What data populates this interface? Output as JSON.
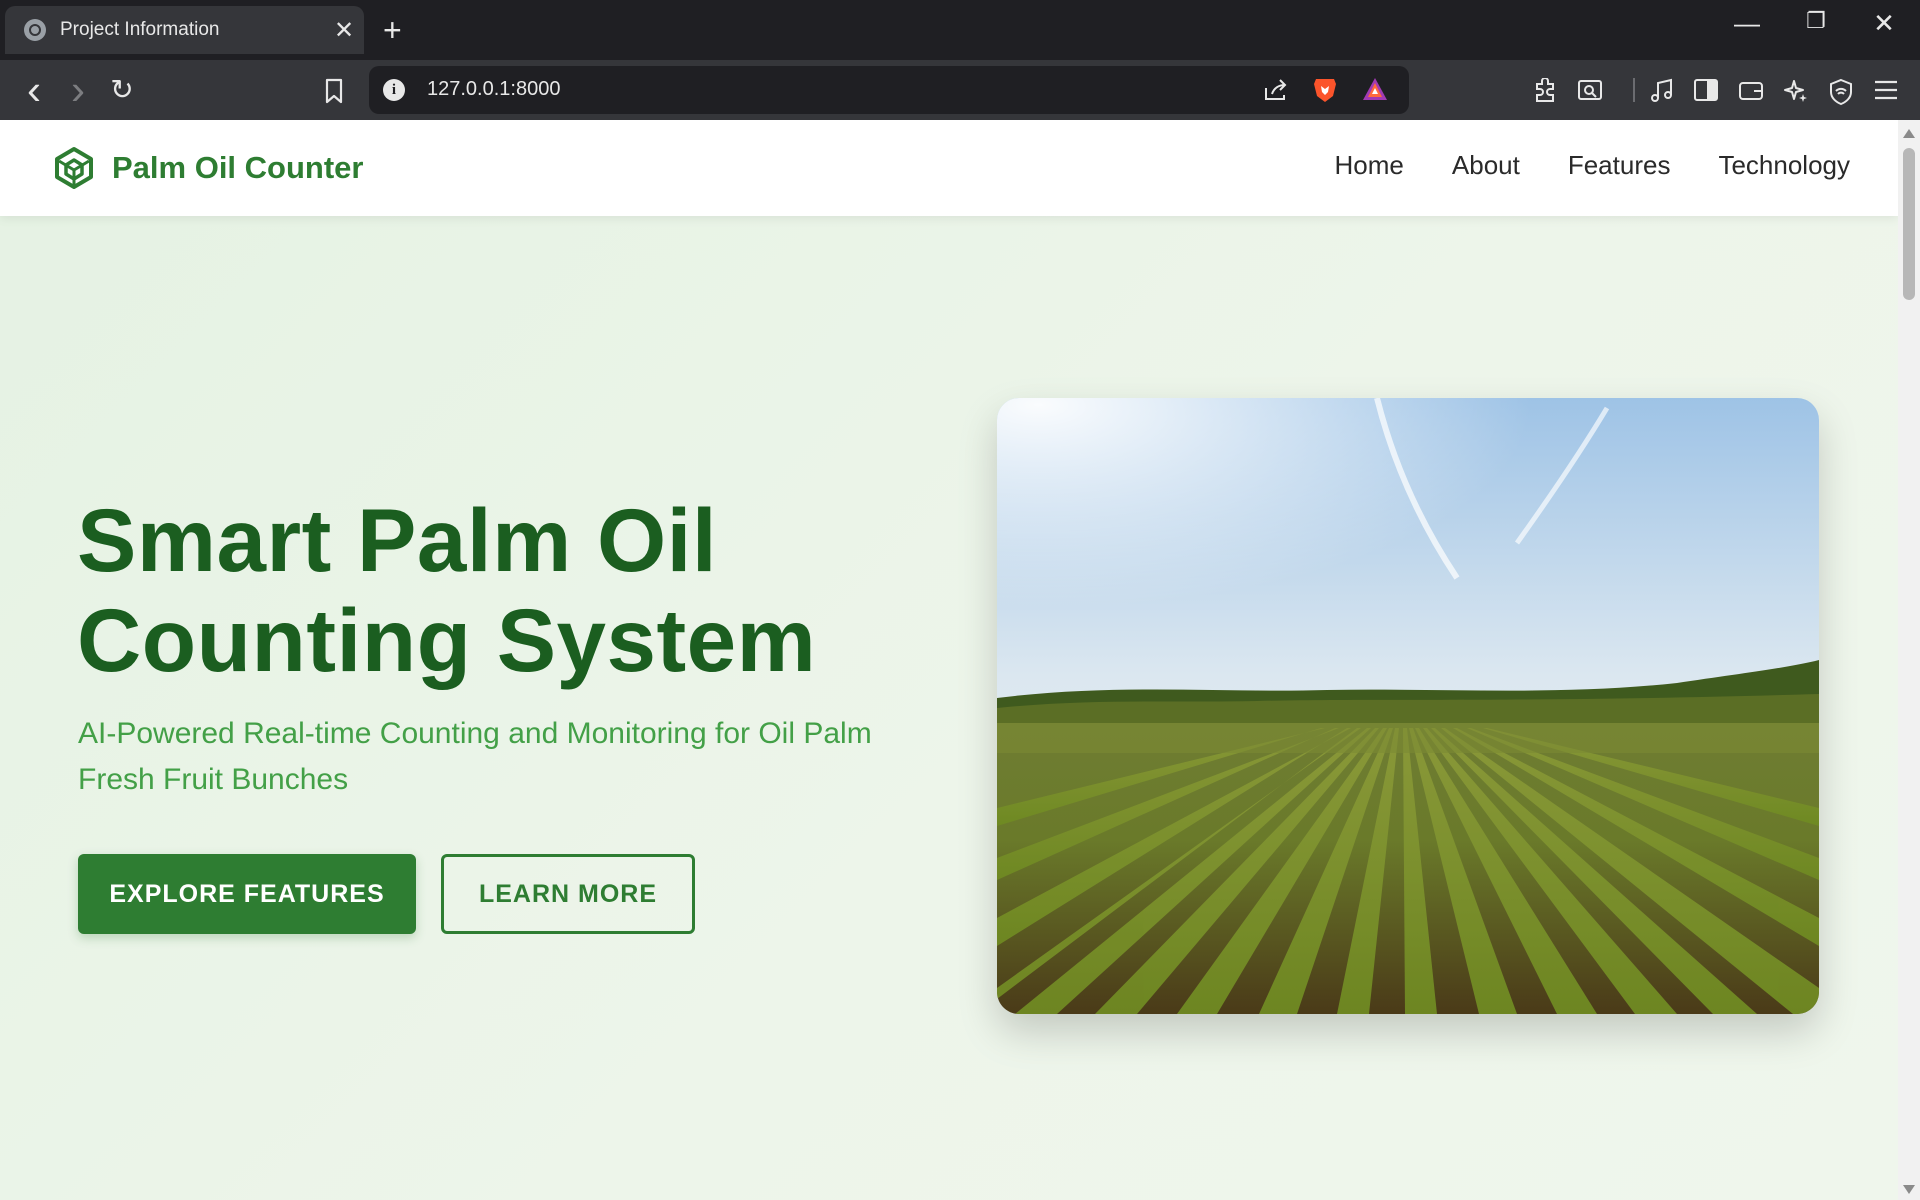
{
  "browser": {
    "tab_title": "Project Information",
    "tab_close": "✕",
    "new_tab": "+",
    "url": "127.0.0.1:8000",
    "info_glyph": "i",
    "window_controls": {
      "minimize": "—",
      "restore": "❐",
      "close": "✕"
    },
    "nav": {
      "back": "‹",
      "forward": "›",
      "reload": "↻"
    },
    "toolbar_icons": [
      "bookmark-icon",
      "share-icon",
      "brave-shields-icon",
      "brave-rewards-icon",
      "extensions-icon",
      "screenshot-icon",
      "media-icon",
      "sidebar-icon",
      "wallet-icon",
      "leo-ai-icon",
      "vpn-icon",
      "menu-icon"
    ]
  },
  "site": {
    "brand_name": "Palm Oil Counter",
    "nav_links": [
      "Home",
      "About",
      "Features",
      "Technology"
    ],
    "hero": {
      "title_line1": "Smart Palm Oil",
      "title_line2": "Counting System",
      "subtitle": "AI-Powered Real-time Counting and Monitoring for Oil Palm Fresh Fruit Bunches",
      "primary_button": "EXPLORE FEATURES",
      "secondary_button": "LEARN MORE"
    },
    "colors": {
      "brand": "#2e7d32",
      "title": "#1b5e20",
      "subtitle": "#43a047"
    }
  }
}
